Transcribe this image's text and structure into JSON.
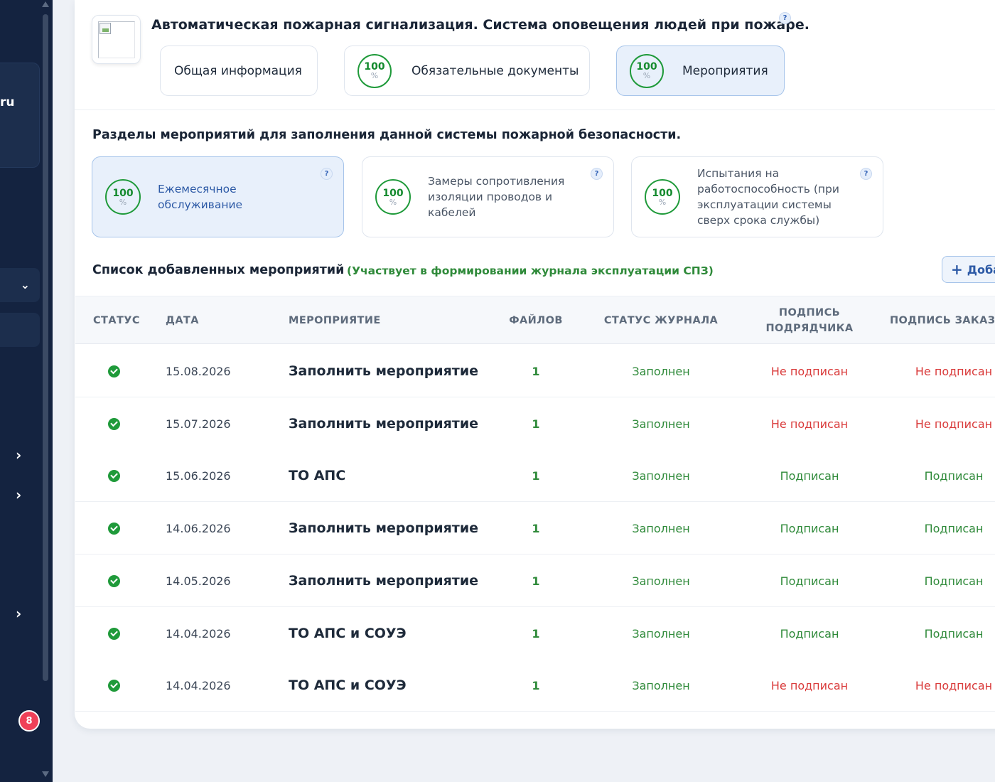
{
  "sidebar": {
    "brand_text": "ru",
    "notification_count": "8"
  },
  "header": {
    "title": "Автоматическая пожарная сигнализация. Система оповещения людей при пожаре.",
    "help": "?",
    "tabs": [
      {
        "label": "Общая информация",
        "progress": null
      },
      {
        "label": "Обязательные документы",
        "progress": "100",
        "unit": "%"
      },
      {
        "label": "Мероприятия",
        "progress": "100",
        "unit": "%",
        "active": true
      }
    ]
  },
  "sections": {
    "title": "Разделы мероприятий для заполнения данной системы пожарной безопасности.",
    "cards": [
      {
        "label": "Ежемесячное обслуживание",
        "progress": "100",
        "unit": "%",
        "active": true,
        "help": "?"
      },
      {
        "label": "Замеры сопротивления изоляции проводов и кабелей",
        "progress": "100",
        "unit": "%",
        "help": "?"
      },
      {
        "label": "Испытания на работоспособность (при эксплуатации системы сверх срока службы)",
        "progress": "100",
        "unit": "%",
        "help": "?"
      }
    ]
  },
  "list": {
    "title": "Список добавленных мероприятий",
    "note": "(Участвует в формировании журнала эксплуатации СПЗ)",
    "add_button": "Доба",
    "add_icon": "plus-icon"
  },
  "table": {
    "headers": {
      "status": "Статус",
      "date": "Дата",
      "event": "Мероприятие",
      "files": "Файлов",
      "journal": "Статус журнала",
      "contractor_1": "Подпись",
      "contractor_2": "подрядчика",
      "customer": "Подпись заказч"
    },
    "rows": [
      {
        "date": "15.08.2026",
        "event": "Заполнить мероприятие",
        "files": "1",
        "journal": "Заполнен",
        "contractor": "Не подписан",
        "customer": "Не подписан",
        "signed": false
      },
      {
        "date": "15.07.2026",
        "event": "Заполнить мероприятие",
        "files": "1",
        "journal": "Заполнен",
        "contractor": "Не подписан",
        "customer": "Не подписан",
        "signed": false
      },
      {
        "date": "15.06.2026",
        "event": "ТО АПС",
        "files": "1",
        "journal": "Заполнен",
        "contractor": "Подписан",
        "customer": "Подписан",
        "signed": true
      },
      {
        "date": "14.06.2026",
        "event": "Заполнить мероприятие",
        "files": "1",
        "journal": "Заполнен",
        "contractor": "Подписан",
        "customer": "Подписан",
        "signed": true
      },
      {
        "date": "14.05.2026",
        "event": "Заполнить мероприятие",
        "files": "1",
        "journal": "Заполнен",
        "contractor": "Подписан",
        "customer": "Подписан",
        "signed": true
      },
      {
        "date": "14.04.2026",
        "event": "ТО АПС и СОУЭ",
        "files": "1",
        "journal": "Заполнен",
        "contractor": "Подписан",
        "customer": "Подписан",
        "signed": true
      },
      {
        "date": "14.04.2026",
        "event": "ТО АПС и СОУЭ",
        "files": "1",
        "journal": "Заполнен",
        "contractor": "Не подписан",
        "customer": "Не подписан",
        "signed": false
      }
    ]
  },
  "colors": {
    "sidebar": "#142340",
    "success": "#2f8a3a",
    "danger": "#d93a3a",
    "accent": "#2d5aa6"
  }
}
